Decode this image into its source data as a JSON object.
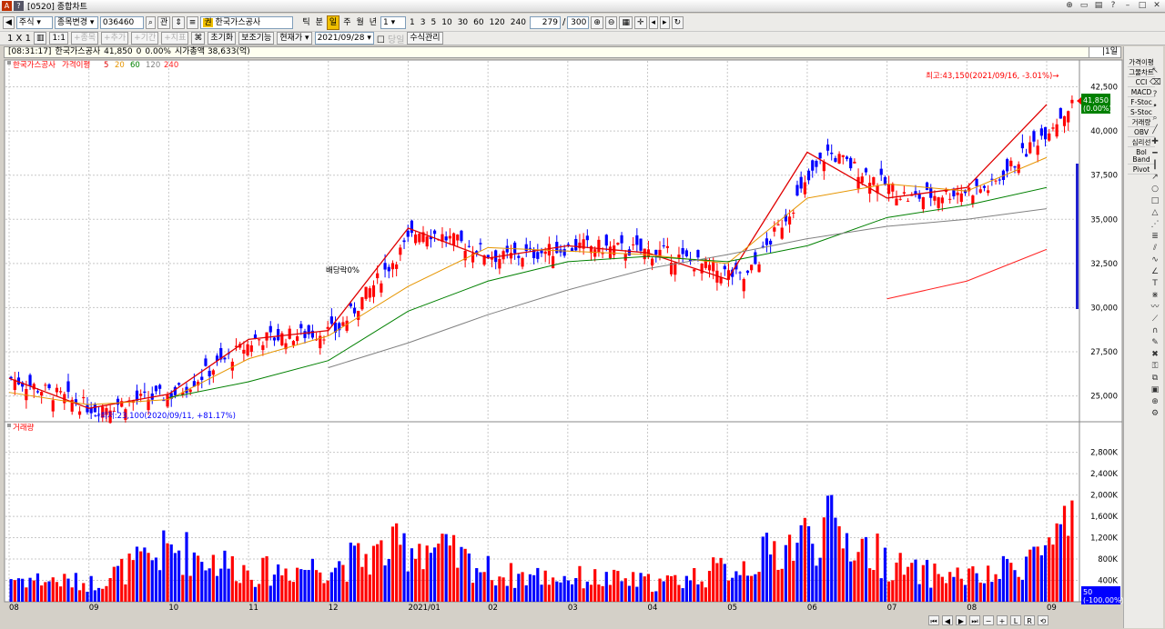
{
  "window": {
    "title": "[0520] 종합차트"
  },
  "toolbar1": {
    "market": "주식",
    "mode": "종목변경",
    "code": "036460",
    "btn_search_label": "관",
    "stock_name": "한국가스공사",
    "periods": [
      "틱",
      "분",
      "일",
      "주",
      "월",
      "년"
    ],
    "active_period_index": 2,
    "unit_value": "1",
    "intervals": [
      "1",
      "3",
      "5",
      "10",
      "30",
      "60",
      "120",
      "240"
    ],
    "count": "279",
    "sep": "/",
    "total": "300"
  },
  "toolbar2": {
    "scale": "1 X 1",
    "dim_buttons": [
      "+종목",
      "+추가",
      "+기간",
      "+지표"
    ],
    "reset": "초기화",
    "aux": "보조기능",
    "price_type": "현재가",
    "date": "2021/09/28",
    "check_label": "당일",
    "formula": "수식관리"
  },
  "info": {
    "time": "[08:31:17]",
    "name": "한국가스공사",
    "price": "41,850",
    "change": "0",
    "rate": "0.00%",
    "mcap": "시가총액 38,633(억)",
    "period": "|1일"
  },
  "price_panel": {
    "legend_name": "한국가스공사",
    "legend_ma": "가격이평",
    "ma_labels": [
      "5",
      "20",
      "60",
      "120",
      "240"
    ],
    "high_label": "최고:43,150(2021/09/16, -3.01%)→",
    "low_label": "←최저:23,100(2020/09/11, +81.17%)",
    "dividend_label": "배당락0%",
    "cur_price": "41,850",
    "cur_rate": "(0.00%)"
  },
  "volume_panel": {
    "legend": "거래량",
    "cur_vol": "50",
    "cur_rate": "(-100.00%)"
  },
  "right_toolbar": [
    "가격이평",
    "그물차트",
    "CCI",
    "MACD",
    "F-Stoc",
    "S-Stoc",
    "거래량",
    "OBV",
    "심리선",
    "Bol Band",
    "Pivot"
  ],
  "colors": {
    "up": "#ff0000",
    "down": "#0000ff",
    "ma5": "#e00000",
    "ma20": "#e69500",
    "ma60": "#008000",
    "ma120": "#808080",
    "ma240": "#ff2020"
  },
  "chart_data": [
    {
      "type": "line",
      "title": "한국가스공사 가격이평",
      "x": [
        "2020/08",
        "2020/09",
        "2020/10",
        "2020/11",
        "2020/12",
        "2021/01",
        "2021/02",
        "2021/03",
        "2021/04",
        "2021/05",
        "2021/06",
        "2021/07",
        "2021/08",
        "2021/09"
      ],
      "series": [
        {
          "name": "5",
          "values": [
            26000,
            24300,
            25100,
            28200,
            28700,
            34500,
            32800,
            33500,
            33100,
            31600,
            38800,
            36200,
            36800,
            41500
          ]
        },
        {
          "name": "20",
          "values": [
            25200,
            24500,
            24800,
            27100,
            28400,
            31200,
            33400,
            33200,
            33000,
            32500,
            36200,
            37000,
            36600,
            38500
          ]
        },
        {
          "name": "60",
          "values": [
            null,
            null,
            24900,
            25800,
            27000,
            29800,
            31500,
            32600,
            32900,
            32600,
            33500,
            35100,
            35800,
            36800
          ]
        },
        {
          "name": "120",
          "values": [
            null,
            null,
            null,
            null,
            26600,
            28000,
            29600,
            31000,
            32200,
            33000,
            33900,
            34600,
            35000,
            35600
          ]
        },
        {
          "name": "240",
          "values": [
            null,
            null,
            null,
            null,
            null,
            null,
            null,
            null,
            null,
            null,
            null,
            30500,
            31500,
            33300
          ]
        }
      ],
      "ylim": [
        24000,
        43300
      ],
      "yticks": [
        "25,000",
        "27,500",
        "30,000",
        "32,500",
        "35,000",
        "37,500",
        "40,000",
        "42,500"
      ],
      "xticks": [
        "08",
        "09",
        "10",
        "11",
        "12",
        "2021/01",
        "02",
        "03",
        "04",
        "05",
        "06",
        "07",
        "08",
        "09"
      ],
      "grid": true
    },
    {
      "type": "bar",
      "title": "거래량",
      "categories": [
        "2020/08",
        "2020/09",
        "2020/10",
        "2020/11",
        "2020/12",
        "2021/01",
        "2021/02",
        "2021/03",
        "2021/04",
        "2021/05",
        "2021/06",
        "2021/07",
        "2021/08",
        "2021/09"
      ],
      "values": [
        450,
        350,
        1000,
        550,
        700,
        1100,
        500,
        450,
        350,
        700,
        1400,
        550,
        450,
        1300
      ],
      "ylim": [
        0,
        3100
      ],
      "yticks": [
        "400K",
        "800K",
        "1,200K",
        "1,600K",
        "2,000K",
        "2,400K",
        "2,800K"
      ],
      "grid": true
    }
  ]
}
